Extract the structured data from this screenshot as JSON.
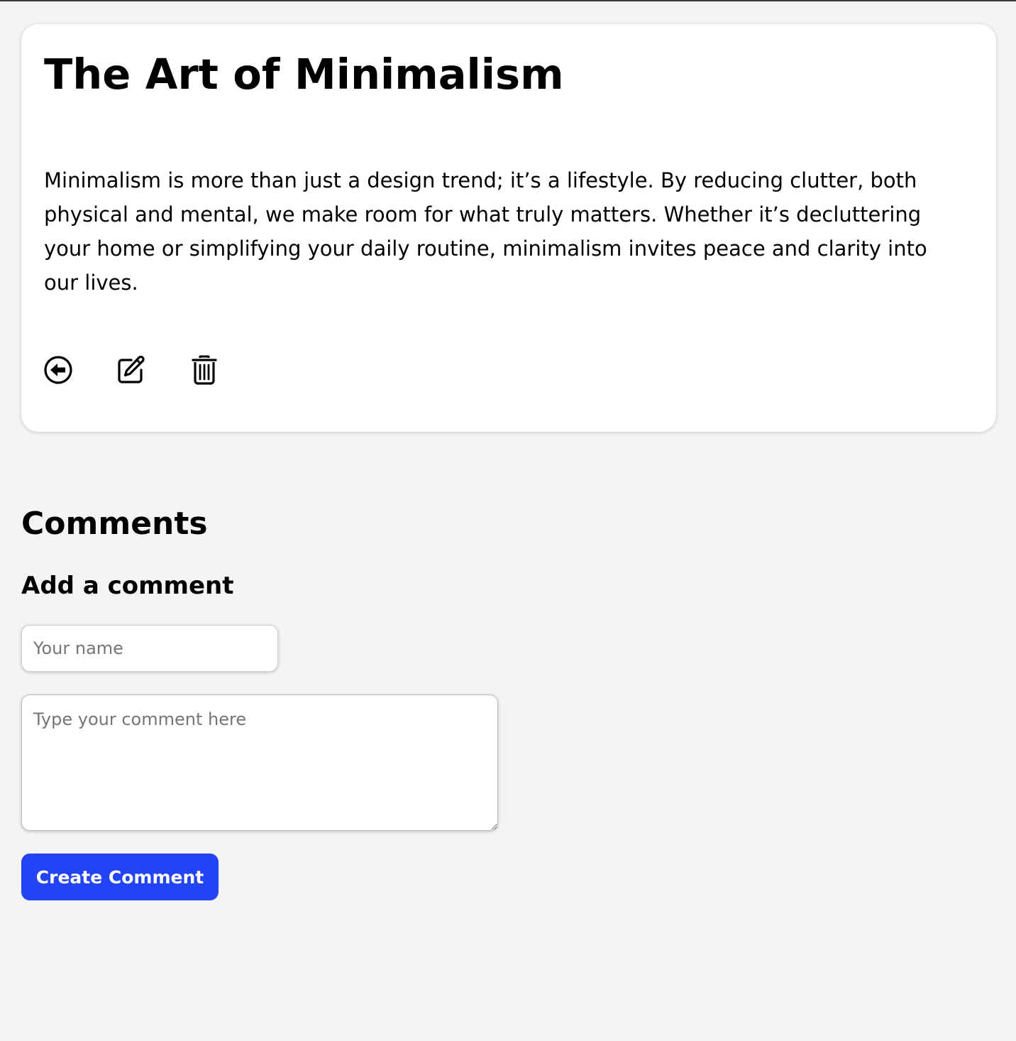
{
  "post": {
    "title": "The Art of Minimalism",
    "body": "Minimalism is more than just a design trend; it’s a lifestyle. By reducing clutter, both physical and mental, we make room for what truly matters. Whether it’s decluttering your home or simplifying your daily routine, minimalism invites peace and clarity into our lives.",
    "actions": {
      "back_icon": "arrow-left-circle-icon",
      "edit_icon": "pencil-square-icon",
      "delete_icon": "trash-icon"
    }
  },
  "comments": {
    "heading": "Comments",
    "form": {
      "heading": "Add a comment",
      "name_placeholder": "Your name",
      "name_value": "",
      "comment_placeholder": "Type your comment here",
      "comment_value": "",
      "submit_label": "Create Comment"
    }
  },
  "colors": {
    "background": "#f4f4f4",
    "card": "#ffffff",
    "text": "#000000",
    "primary_button": "#2244f5",
    "placeholder": "#757575"
  }
}
